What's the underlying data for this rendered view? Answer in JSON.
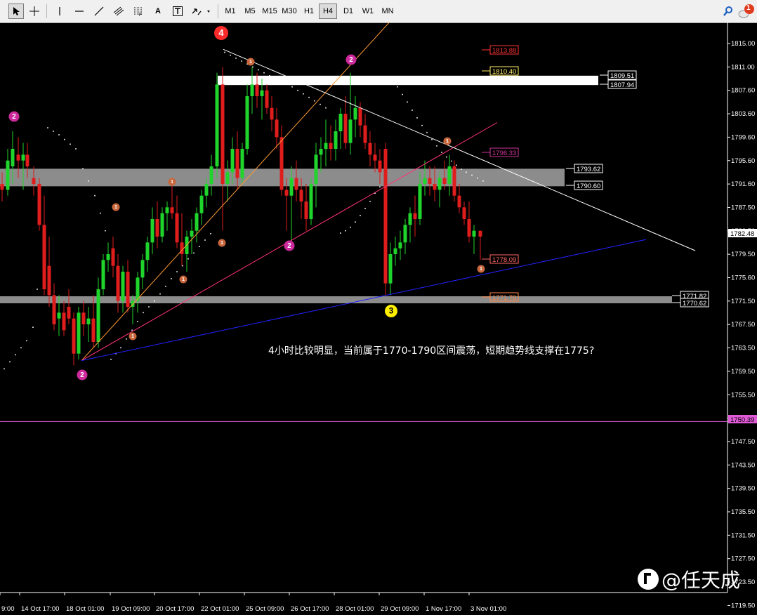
{
  "toolbar": {
    "timeframes": [
      "M1",
      "M5",
      "M15",
      "M30",
      "H1",
      "H4",
      "D1",
      "W1",
      "MN"
    ],
    "active_timeframe": "H4",
    "notification_count": "1"
  },
  "chart": {
    "background": "#000000",
    "bull_color": "#1fd52b",
    "bear_color": "#e01d1d",
    "annotation_text": "4小时比较明显，当前属于1770-1790区间震荡，短期趋势线支撑在1775?",
    "watermark": "@任天成",
    "wave_labels": [
      {
        "text": "4",
        "color": "#ff2b2b"
      },
      {
        "text": "3",
        "color": "#ffee00"
      },
      {
        "text": "2",
        "color": "#cc2a9c"
      },
      {
        "text": "1",
        "color": "#c8663b"
      }
    ],
    "price_axis": [
      "1815.00",
      "1811.00",
      "1807.60",
      "1803.60",
      "1799.60",
      "1795.60",
      "1791.60",
      "1787.50",
      "1783.50",
      "1779.50",
      "1775.60",
      "1771.50",
      "1767.50",
      "1763.50",
      "1759.50",
      "1755.50",
      "1751.50",
      "1747.50",
      "1743.50",
      "1739.50",
      "1735.50",
      "1731.50",
      "1727.50",
      "1723.50",
      "1719.50"
    ],
    "current_price": "1782.48",
    "line_price": "1750.39",
    "zone_labels": [
      {
        "price": "1809.51",
        "color": "#ffffff"
      },
      {
        "price": "1807.94",
        "color": "#ffffff"
      },
      {
        "price": "1793.62",
        "color": "#ffffff"
      },
      {
        "price": "1790.60",
        "color": "#ffffff"
      },
      {
        "price": "1771.82",
        "color": "#ffffff"
      },
      {
        "price": "1770.62",
        "color": "#ffffff"
      }
    ],
    "level_labels": [
      {
        "price": "1813.88",
        "color": "#ff3333"
      },
      {
        "price": "1810.40",
        "color": "#ffee66"
      },
      {
        "price": "1796.33",
        "color": "#cc3399"
      },
      {
        "price": "1778.09",
        "color": "#ff6666"
      },
      {
        "price": "1771.70",
        "color": "#ff8844"
      }
    ],
    "time_axis": [
      "9:00",
      "14 Oct 17:00",
      "18 Oct 01:00",
      "19 Oct 09:00",
      "20 Oct 17:00",
      "22 Oct 01:00",
      "25 Oct 09:00",
      "26 Oct 17:00",
      "28 Oct 01:00",
      "29 Oct 09:00",
      "1 Nov 17:00",
      "3 Nov 01:00"
    ]
  }
}
